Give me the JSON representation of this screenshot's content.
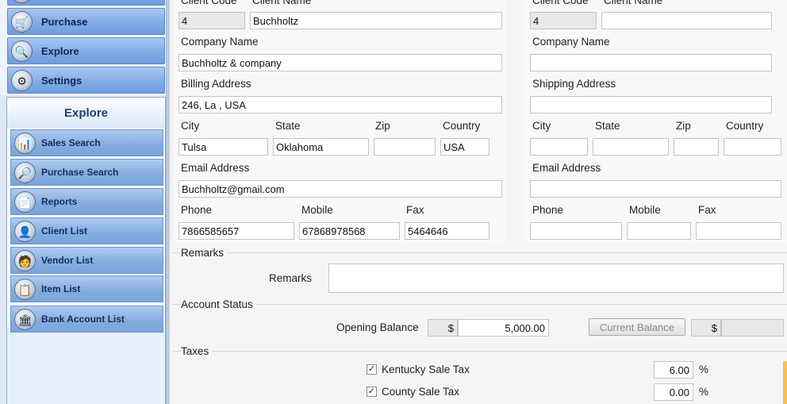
{
  "nav": {
    "top_buttons": [
      {
        "label": "Purchase",
        "icon": "purchase-icon"
      },
      {
        "label": "Explore",
        "icon": "explore-icon"
      },
      {
        "label": "Settings",
        "icon": "settings-icon"
      }
    ],
    "panel_title": "Explore",
    "items": [
      {
        "label": "Sales Search",
        "icon": "sales-search-icon"
      },
      {
        "label": "Purchase Search",
        "icon": "purchase-search-icon"
      },
      {
        "label": "Reports",
        "icon": "reports-icon"
      },
      {
        "label": "Client List",
        "icon": "client-list-icon"
      },
      {
        "label": "Vendor List",
        "icon": "vendor-list-icon"
      },
      {
        "label": "Item List",
        "icon": "item-list-icon"
      },
      {
        "label": "Bank Account List",
        "icon": "bank-account-icon"
      }
    ]
  },
  "billing": {
    "client_code_label": "Client Code",
    "client_name_label": "Client Name",
    "client_code": "4",
    "client_name": "Buchholtz",
    "company_name_label": "Company Name",
    "company_name": "Buchholtz & company",
    "address_label": "Billing Address",
    "address": "246, La , USA",
    "city_label": "City",
    "state_label": "State",
    "zip_label": "Zip",
    "country_label": "Country",
    "city": "Tulsa",
    "state": "Oklahoma",
    "zip": "",
    "country": "USA",
    "email_label": "Email Address",
    "email": "Buchholtz@gmail.com",
    "phone_label": "Phone",
    "mobile_label": "Mobile",
    "fax_label": "Fax",
    "phone": "7866585657",
    "mobile": "67868978568",
    "fax": "5464646"
  },
  "shipping": {
    "client_code_label": "Client Code",
    "client_name_label": "Client Name",
    "client_code": "4",
    "client_name": "",
    "company_name_label": "Company Name",
    "company_name": "",
    "address_label": "Shipping Address",
    "address": "",
    "city_label": "City",
    "state_label": "State",
    "zip_label": "Zip",
    "country_label": "Country",
    "email_label": "Email Address",
    "phone_label": "Phone",
    "mobile_label": "Mobile",
    "fax_label": "Fax"
  },
  "remarks": {
    "group_title": "Remarks",
    "label": "Remarks",
    "value": ""
  },
  "account_status": {
    "group_title": "Account Status",
    "opening_balance_label": "Opening Balance",
    "currency_symbol": "$",
    "opening_balance": "5,000.00",
    "current_balance_button": "Current Balance",
    "current_balance": ""
  },
  "taxes": {
    "group_title": "Taxes",
    "items": [
      {
        "label": "Kentucky Sale Tax",
        "checked": true,
        "rate": "6.00",
        "unit": "%"
      },
      {
        "label": "County Sale Tax",
        "checked": true,
        "rate": "0.00",
        "unit": "%"
      }
    ],
    "check_mark": "✓"
  },
  "colors": {
    "nav_button": "#81abe6",
    "nav_panel_title": "#1d3f73",
    "accent_edge": "#f4c25a"
  }
}
